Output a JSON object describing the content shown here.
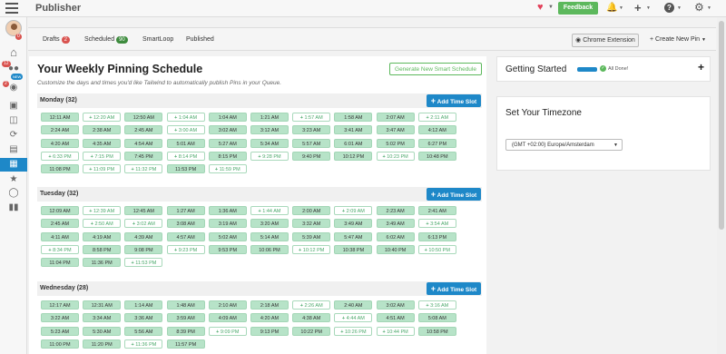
{
  "topbar": {
    "title": "Publisher",
    "feedback": "Feedback",
    "icons": [
      "menu-icon",
      "heart-icon",
      "bell-icon",
      "plus-icon",
      "help-icon",
      "gear-icon"
    ]
  },
  "sidebar": {
    "badge_avatar": "0",
    "badge_tribes": "12",
    "badge_new": "NEW",
    "badge_pins": "2"
  },
  "nav": {
    "tabs": [
      {
        "label": "Drafts",
        "count": "2",
        "color": "#d9534f"
      },
      {
        "label": "Scheduled",
        "count": "90",
        "color": "#3d8b3d"
      },
      {
        "label": "SmartLoop"
      },
      {
        "label": "Published"
      }
    ],
    "chrome_ext": "Chrome Extension",
    "create_pin": "+ Create New Pin"
  },
  "schedule": {
    "title": "Your Weekly Pinning Schedule",
    "subtitle": "Customize the days and times you'd like Tailwind to automatically publish Pins in your Queue.",
    "generate_label": "Generate New Smart Schedule",
    "add_label": "Add Time Slot"
  },
  "days": [
    {
      "name": "Monday (32)",
      "slots": [
        [
          "12:11 AM",
          1
        ],
        [
          "12:20 AM",
          0
        ],
        [
          "12:50 AM",
          1
        ],
        [
          "1:04 AM",
          0
        ],
        [
          "1:04 AM",
          1
        ],
        [
          "1:21 AM",
          1
        ],
        [
          "1:57 AM",
          0
        ],
        [
          "1:58 AM",
          1
        ],
        [
          "2:07 AM",
          1
        ],
        [
          "2:11 AM",
          0
        ],
        [
          "2:24 AM",
          1
        ],
        [
          "2:38 AM",
          1
        ],
        [
          "2:45 AM",
          1
        ],
        [
          "3:00 AM",
          0
        ],
        [
          "3:02 AM",
          1
        ],
        [
          "3:12 AM",
          1
        ],
        [
          "3:23 AM",
          1
        ],
        [
          "3:41 AM",
          1
        ],
        [
          "3:47 AM",
          1
        ],
        [
          "4:12 AM",
          1
        ],
        [
          "4:20 AM",
          1
        ],
        [
          "4:35 AM",
          1
        ],
        [
          "4:54 AM",
          1
        ],
        [
          "5:01 AM",
          1
        ],
        [
          "5:27 AM",
          1
        ],
        [
          "5:34 AM",
          1
        ],
        [
          "5:57 AM",
          1
        ],
        [
          "6:01 AM",
          1
        ],
        [
          "5:02 PM",
          1
        ],
        [
          "6:27 PM",
          1
        ],
        [
          "6:33 PM",
          0
        ],
        [
          "7:15 PM",
          0
        ],
        [
          "7:45 PM",
          1
        ],
        [
          "8:14 PM",
          0
        ],
        [
          "8:15 PM",
          1
        ],
        [
          "9:28 PM",
          0
        ],
        [
          "9:40 PM",
          1
        ],
        [
          "10:12 PM",
          1
        ],
        [
          "10:23 PM",
          0
        ],
        [
          "10:48 PM",
          1
        ],
        [
          "11:08 PM",
          1
        ],
        [
          "11:09 PM",
          0
        ],
        [
          "11:32 PM",
          0
        ],
        [
          "11:53 PM",
          1
        ],
        [
          "11:59 PM",
          0
        ]
      ]
    },
    {
      "name": "Tuesday (32)",
      "slots": [
        [
          "12:09 AM",
          1
        ],
        [
          "12:39 AM",
          0
        ],
        [
          "12:45 AM",
          1
        ],
        [
          "1:27 AM",
          1
        ],
        [
          "1:36 AM",
          1
        ],
        [
          "1:44 AM",
          0
        ],
        [
          "2:00 AM",
          1
        ],
        [
          "2:09 AM",
          0
        ],
        [
          "2:23 AM",
          1
        ],
        [
          "2:41 AM",
          1
        ],
        [
          "2:45 AM",
          1
        ],
        [
          "2:50 AM",
          0
        ],
        [
          "3:02 AM",
          0
        ],
        [
          "3:08 AM",
          1
        ],
        [
          "3:19 AM",
          1
        ],
        [
          "3:20 AM",
          1
        ],
        [
          "3:32 AM",
          1
        ],
        [
          "3:49 AM",
          1
        ],
        [
          "3:49 AM",
          1
        ],
        [
          "3:54 AM",
          0
        ],
        [
          "4:11 AM",
          1
        ],
        [
          "4:19 AM",
          1
        ],
        [
          "4:39 AM",
          1
        ],
        [
          "4:57 AM",
          1
        ],
        [
          "5:02 AM",
          1
        ],
        [
          "5:14 AM",
          1
        ],
        [
          "5:39 AM",
          1
        ],
        [
          "5:47 AM",
          1
        ],
        [
          "6:02 AM",
          1
        ],
        [
          "6:13 PM",
          1
        ],
        [
          "8:34 PM",
          0
        ],
        [
          "8:58 PM",
          1
        ],
        [
          "9:08 PM",
          1
        ],
        [
          "9:23 PM",
          0
        ],
        [
          "9:53 PM",
          1
        ],
        [
          "10:06 PM",
          1
        ],
        [
          "10:12 PM",
          0
        ],
        [
          "10:38 PM",
          1
        ],
        [
          "10:40 PM",
          1
        ],
        [
          "10:50 PM",
          0
        ],
        [
          "11:04 PM",
          1
        ],
        [
          "11:36 PM",
          1
        ],
        [
          "11:53 PM",
          0
        ]
      ]
    },
    {
      "name": "Wednesday (28)",
      "slots": [
        [
          "12:17 AM",
          1
        ],
        [
          "12:31 AM",
          1
        ],
        [
          "1:14 AM",
          1
        ],
        [
          "1:48 AM",
          1
        ],
        [
          "2:10 AM",
          1
        ],
        [
          "2:18 AM",
          1
        ],
        [
          "2:26 AM",
          0
        ],
        [
          "2:40 AM",
          1
        ],
        [
          "3:02 AM",
          1
        ],
        [
          "3:16 AM",
          0
        ],
        [
          "3:22 AM",
          1
        ],
        [
          "3:34 AM",
          1
        ],
        [
          "3:36 AM",
          1
        ],
        [
          "3:59 AM",
          1
        ],
        [
          "4:09 AM",
          1
        ],
        [
          "4:20 AM",
          1
        ],
        [
          "4:38 AM",
          1
        ],
        [
          "4:44 AM",
          0
        ],
        [
          "4:51 AM",
          1
        ],
        [
          "5:08 AM",
          1
        ],
        [
          "5:23 AM",
          1
        ],
        [
          "5:30 AM",
          1
        ],
        [
          "5:56 AM",
          1
        ],
        [
          "8:39 PM",
          1
        ],
        [
          "9:09 PM",
          0
        ],
        [
          "9:13 PM",
          1
        ],
        [
          "10:22 PM",
          1
        ],
        [
          "10:26 PM",
          0
        ],
        [
          "10:44 PM",
          0
        ],
        [
          "10:58 PM",
          1
        ],
        [
          "11:00 PM",
          1
        ],
        [
          "11:20 PM",
          1
        ],
        [
          "11:36 PM",
          0
        ],
        [
          "11:57 PM",
          1
        ]
      ]
    }
  ],
  "getting_started": {
    "title": "Getting Started",
    "done": "All Done!",
    "progress": 1.0
  },
  "timezone": {
    "title": "Set Your Timezone",
    "value": "(GMT +02:00) Europe/Amsterdam"
  }
}
